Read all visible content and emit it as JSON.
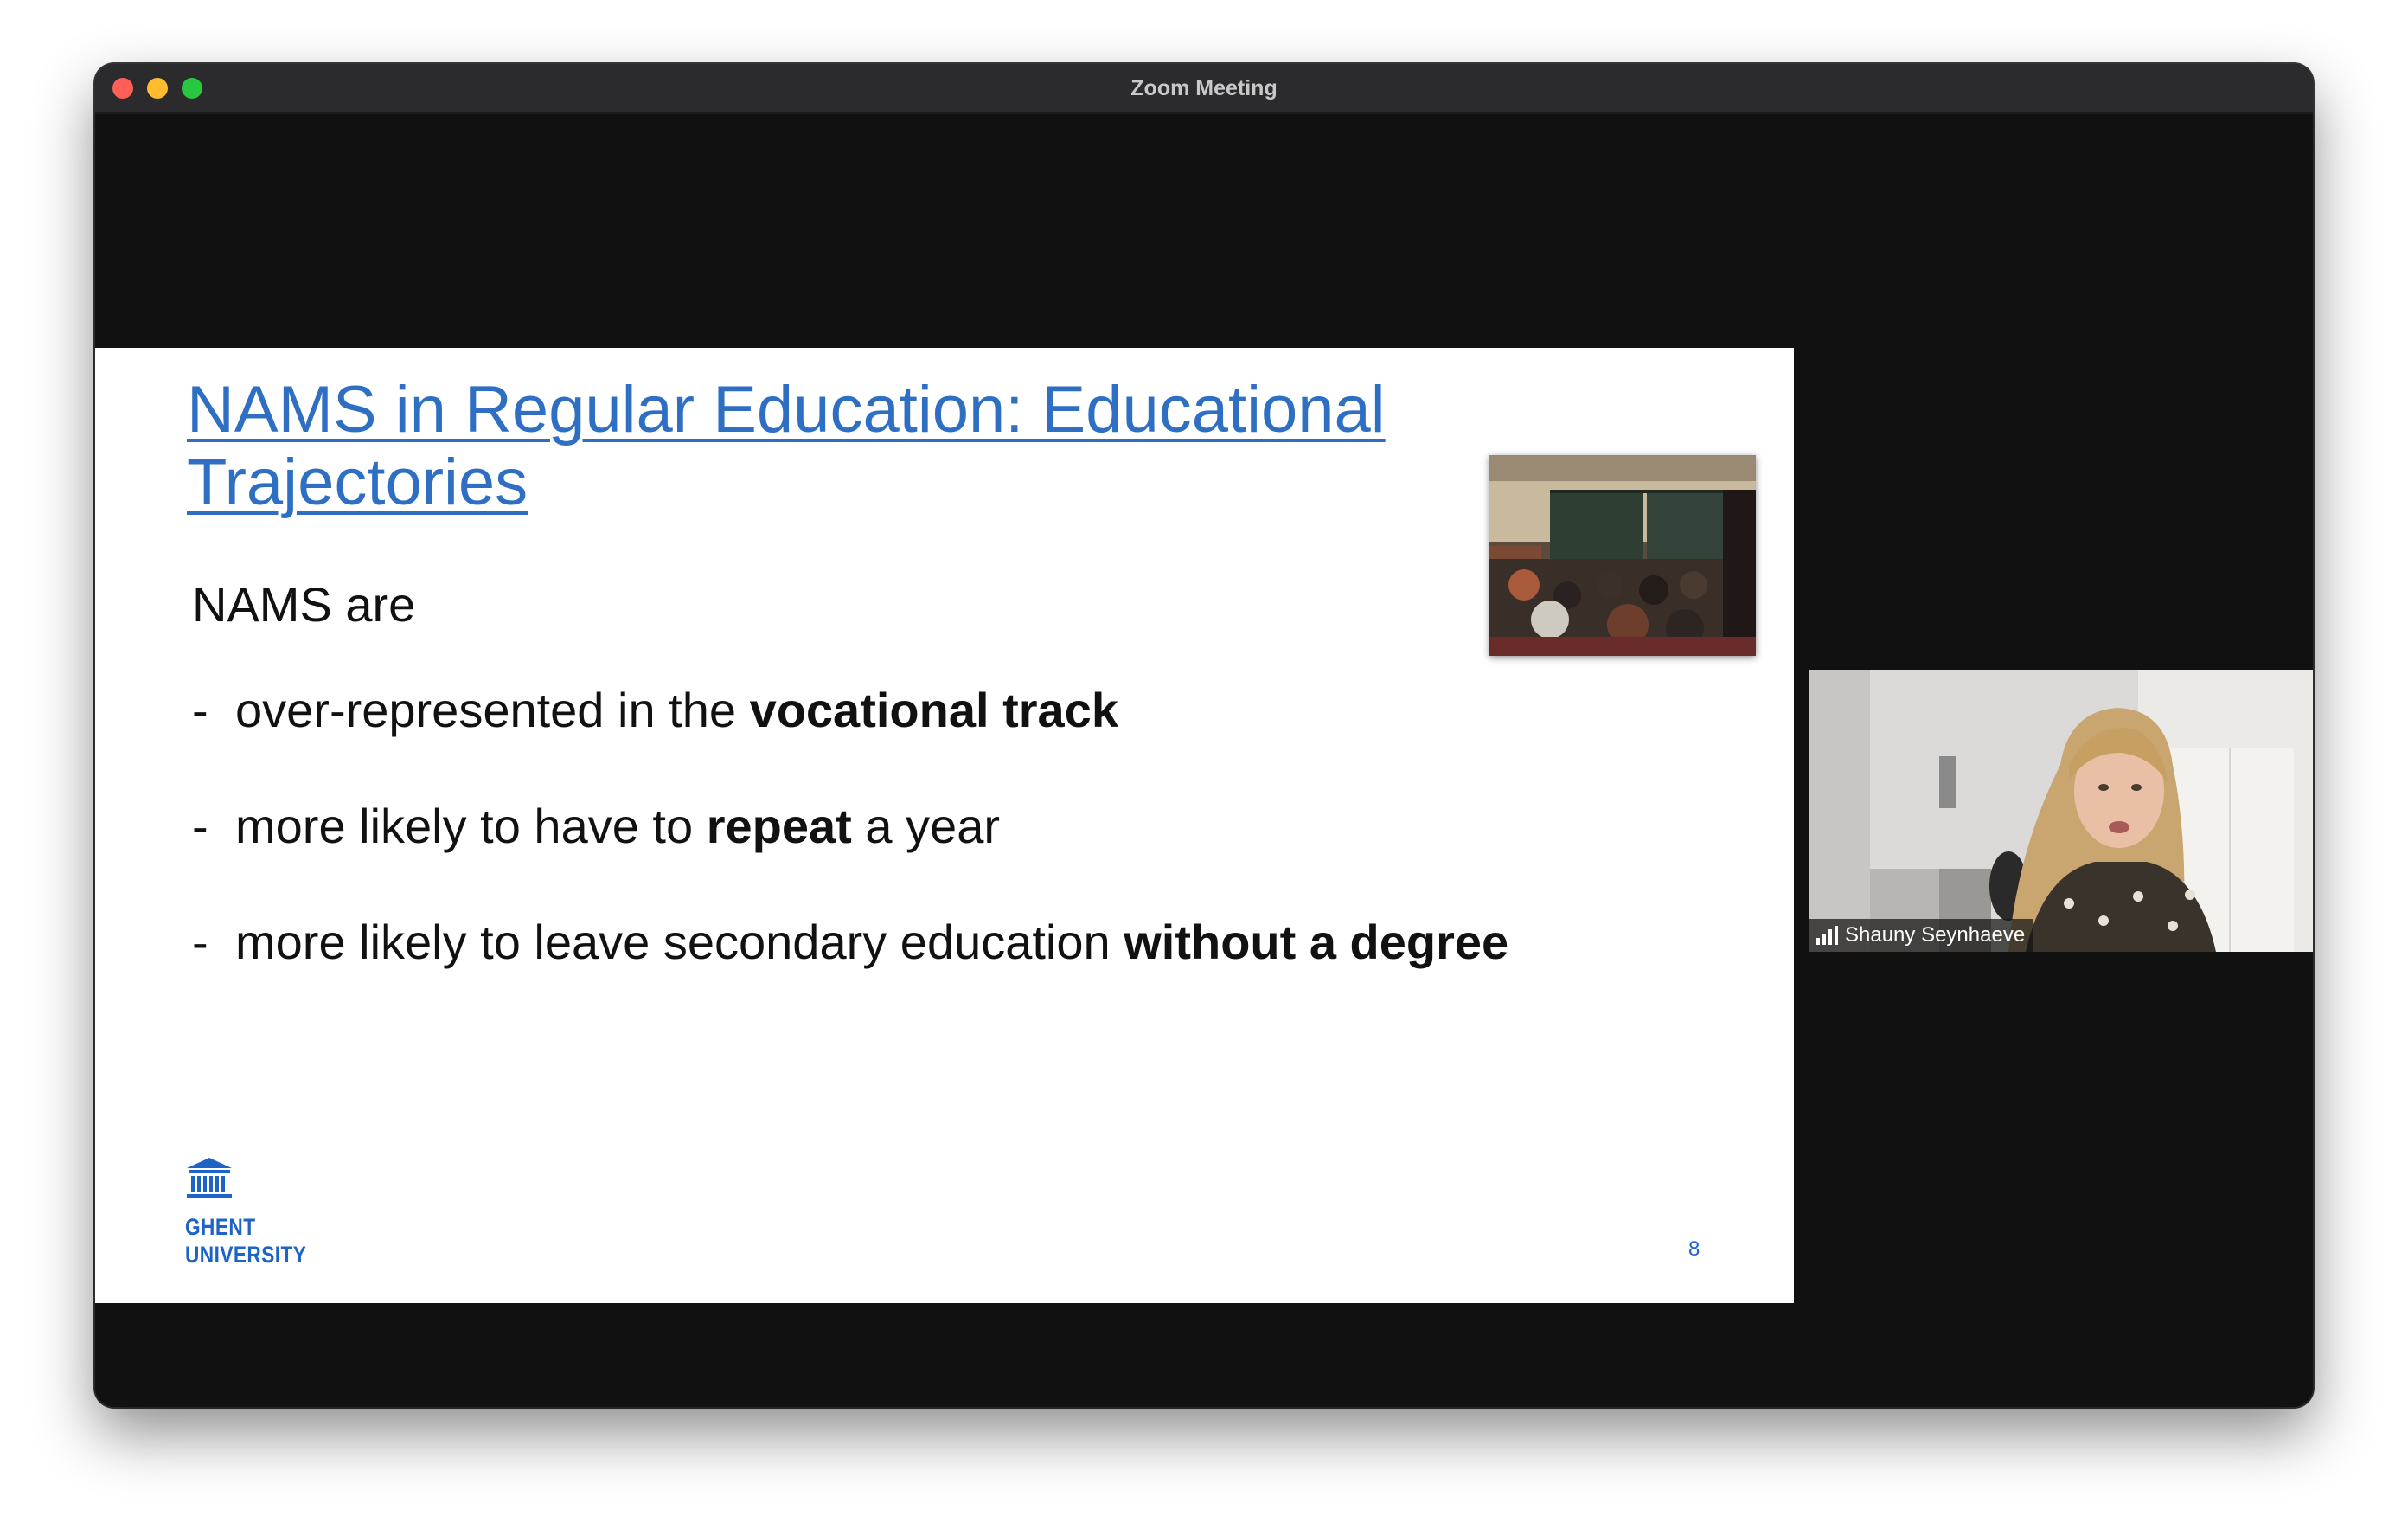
{
  "window": {
    "title": "Zoom Meeting"
  },
  "slide": {
    "title": "NAMS in Regular Education: Educational Trajectories",
    "intro": "NAMS are",
    "bullets": [
      {
        "dash": "-",
        "before": "over-represented in the ",
        "bold": "vocational track",
        "after": ""
      },
      {
        "dash": "-",
        "before": "more likely to have to ",
        "bold": "repeat",
        "after": " a year"
      },
      {
        "dash": "-",
        "before": "more likely to leave secondary education ",
        "bold": "without a degree",
        "after": ""
      }
    ],
    "logo": {
      "line1": "GHENT",
      "line2": "UNIVERSITY",
      "icon": "university-building-icon"
    },
    "page_number": "8",
    "image": "classroom-photo"
  },
  "participant": {
    "name": "Shauny Seynhaeve",
    "icon": "signal-strength-icon"
  },
  "colors": {
    "title_blue": "#2e6fc4",
    "ghent_blue": "#1e64c8",
    "meeting_bg": "#111111",
    "titlebar": "#2b2b2d"
  }
}
